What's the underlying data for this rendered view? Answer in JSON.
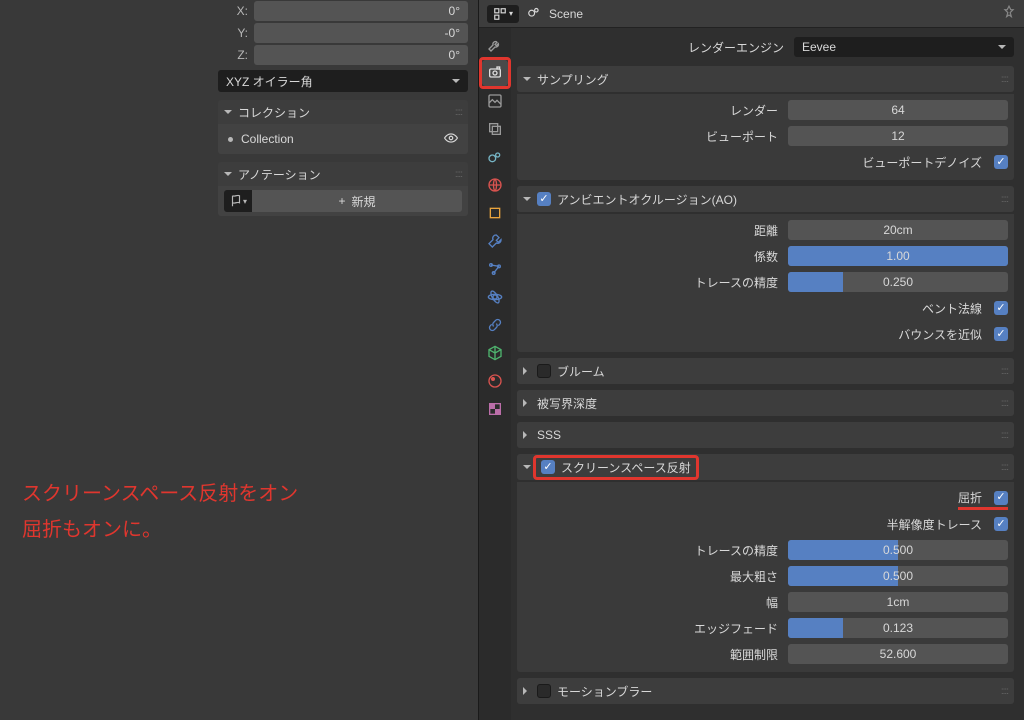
{
  "left": {
    "rotation": {
      "x_label": "X:",
      "x_val": "0°",
      "y_label": "Y:",
      "y_val": "-0°",
      "z_label": "Z:",
      "z_val": "0°"
    },
    "rot_mode": "XYZ オイラー角",
    "panels": {
      "collection_title": "コレクション",
      "collection_item": "Collection",
      "annotation_title": "アノテーション",
      "new_label": "新規",
      "plus": "+"
    }
  },
  "annotation": {
    "line1": "スクリーンスペース反射をオン",
    "line2": "屈折もオンに。"
  },
  "header": {
    "scene_label": "Scene"
  },
  "render": {
    "engine_label": "レンダーエンジン",
    "engine_value": "Eevee",
    "sampling": {
      "title": "サンプリング",
      "render_label": "レンダー",
      "render_val": "64",
      "viewport_label": "ビューポート",
      "viewport_val": "12",
      "denoise_label": "ビューポートデノイズ"
    },
    "ao": {
      "title": "アンビエントオクルージョン(AO)",
      "dist_label": "距離",
      "dist_val": "20cm",
      "factor_label": "係数",
      "factor_val": "1.00",
      "trace_label": "トレースの精度",
      "trace_val": "0.250",
      "bent_label": "ベント法線",
      "bounce_label": "バウンスを近似"
    },
    "bloom": {
      "title": "ブルーム"
    },
    "dof": {
      "title": "被写界深度"
    },
    "sss": {
      "title": "SSS"
    },
    "ssr": {
      "title": "スクリーンスペース反射",
      "refraction_label": "屈折",
      "halfres_label": "半解像度トレース",
      "trace_label": "トレースの精度",
      "trace_val": "0.500",
      "rough_label": "最大粗さ",
      "rough_val": "0.500",
      "thick_label": "幅",
      "thick_val": "1cm",
      "edge_label": "エッジフェード",
      "edge_val": "0.123",
      "clamp_label": "範囲制限",
      "clamp_val": "52.600"
    },
    "motion": {
      "title": "モーションブラー"
    }
  },
  "chart_data": null
}
